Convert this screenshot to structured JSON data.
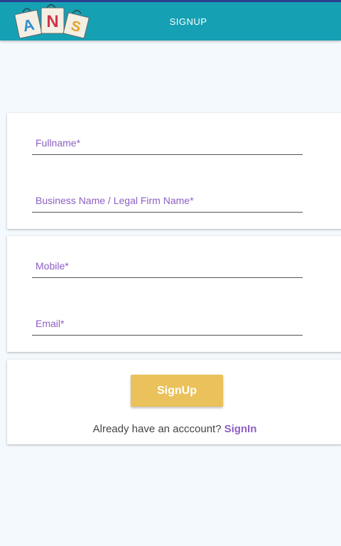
{
  "header": {
    "logo_letters": [
      "A",
      "N",
      "S"
    ],
    "title": "SIGNUP"
  },
  "form": {
    "fullname_placeholder": "Fullname*",
    "business_placeholder": "Business Name / Legal Firm Name*",
    "mobile_placeholder": "Mobile*",
    "email_placeholder": "Email*"
  },
  "actions": {
    "signup_label": "SignUp",
    "have_account_text": "Already have an acccount?",
    "signin_label": "SignIn"
  },
  "colors": {
    "header": "#16a0b4",
    "accent_purple": "#8d5fc4",
    "button": "#eac15a",
    "background": "#f4f9fd"
  }
}
